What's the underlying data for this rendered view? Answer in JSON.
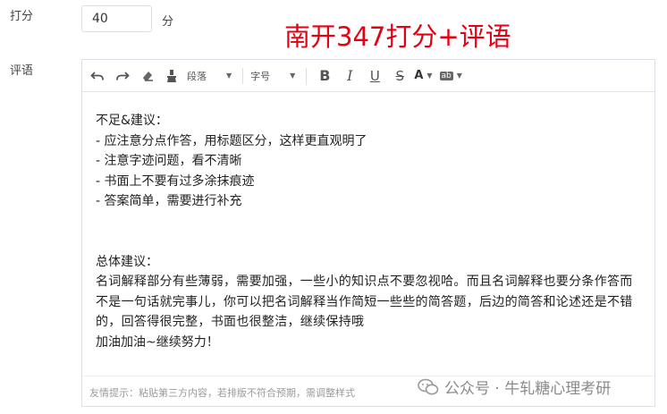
{
  "score": {
    "label": "打分",
    "value": "40",
    "unit": "分"
  },
  "comment": {
    "label": "评语"
  },
  "watermark_title": "南开347打分+评语",
  "toolbar": {
    "paragraph": "段落",
    "font_size": "字号",
    "bold": "B",
    "italic": "I",
    "underline": "U",
    "strikethrough": "S",
    "font_color": "A",
    "bg_color": "ab"
  },
  "content": {
    "shortcomings_heading": "不足&建议：",
    "shortcomings": [
      "- 应注意分点作答，用标题区分，这样更直观明了",
      "- 注意字迹问题，看不清晰",
      "- 书面上不要有过多涂抹痕迹",
      "- 答案简单，需要进行补充"
    ],
    "overall_heading": "总体建议：",
    "overall_text": "名词解释部分有些薄弱，需要加强，一些小的知识点不要忽视哈。而且名词解释也要分条作答而不是一句话就完事儿，你可以把名词解释当作简短一些些的简答题，后边的简答和论述还是不错的，回答得很完整，书面也很整洁，继续保持哦",
    "closing": "加油加油~继续努力！"
  },
  "hint": "友情提示：粘贴第三方内容，若排版不符合预期，需调整样式",
  "wechat_watermark": "公众号 · 牛轧糖心理考研"
}
